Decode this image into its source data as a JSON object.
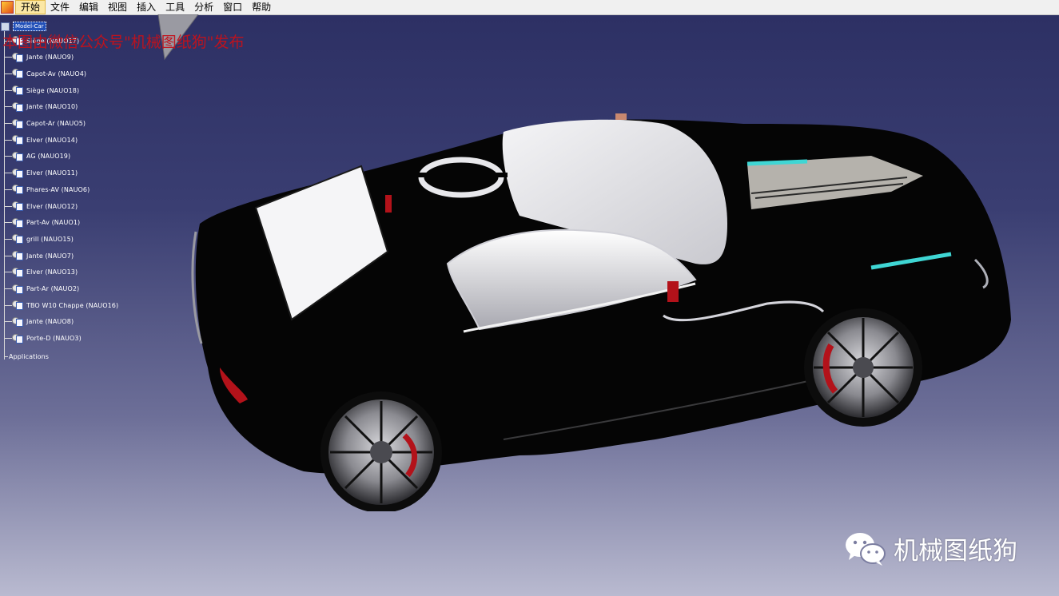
{
  "menubar": {
    "items": [
      "开始",
      "文件",
      "编辑",
      "视图",
      "插入",
      "工具",
      "分析",
      "窗口",
      "帮助"
    ],
    "active_index": 0
  },
  "tree": {
    "root": "Model-Car",
    "nodes": [
      "Siège (NAUO17)",
      "Jante (NAUO9)",
      "Capot-Av (NAUO4)",
      "Siège (NAUO18)",
      "Jante (NAUO10)",
      "Capot-Ar (NAUO5)",
      "Elver (NAUO14)",
      "AG (NAUO19)",
      "Elver (NAUO11)",
      "Phares-AV (NAUO6)",
      "Elver (NAUO12)",
      "Part-Av (NAUO1)",
      "grill (NAUO15)",
      "Jante (NAUO7)",
      "Elver (NAUO13)",
      "Part-Ar (NAUO2)",
      "TBO W10 Chappe (NAUO16)",
      "Jante (NAUO8)",
      "Porte-D (NAUO3)"
    ],
    "applications": "Applications"
  },
  "watermark_top": "本图由微信公众号\"机械图纸狗\"发布",
  "brand": {
    "name": "机械图纸狗",
    "icon": "wechat-icon"
  },
  "colors": {
    "menubar_bg": "#f0f0f0",
    "active_menu": "#fbe7a4",
    "bg_top": "#2c2f63",
    "bg_bottom": "#b9bad0",
    "watermark": "#c4111b",
    "car_body": "#050505",
    "accent_cyan": "#3fd6d4",
    "brake_red": "#b3121a"
  }
}
